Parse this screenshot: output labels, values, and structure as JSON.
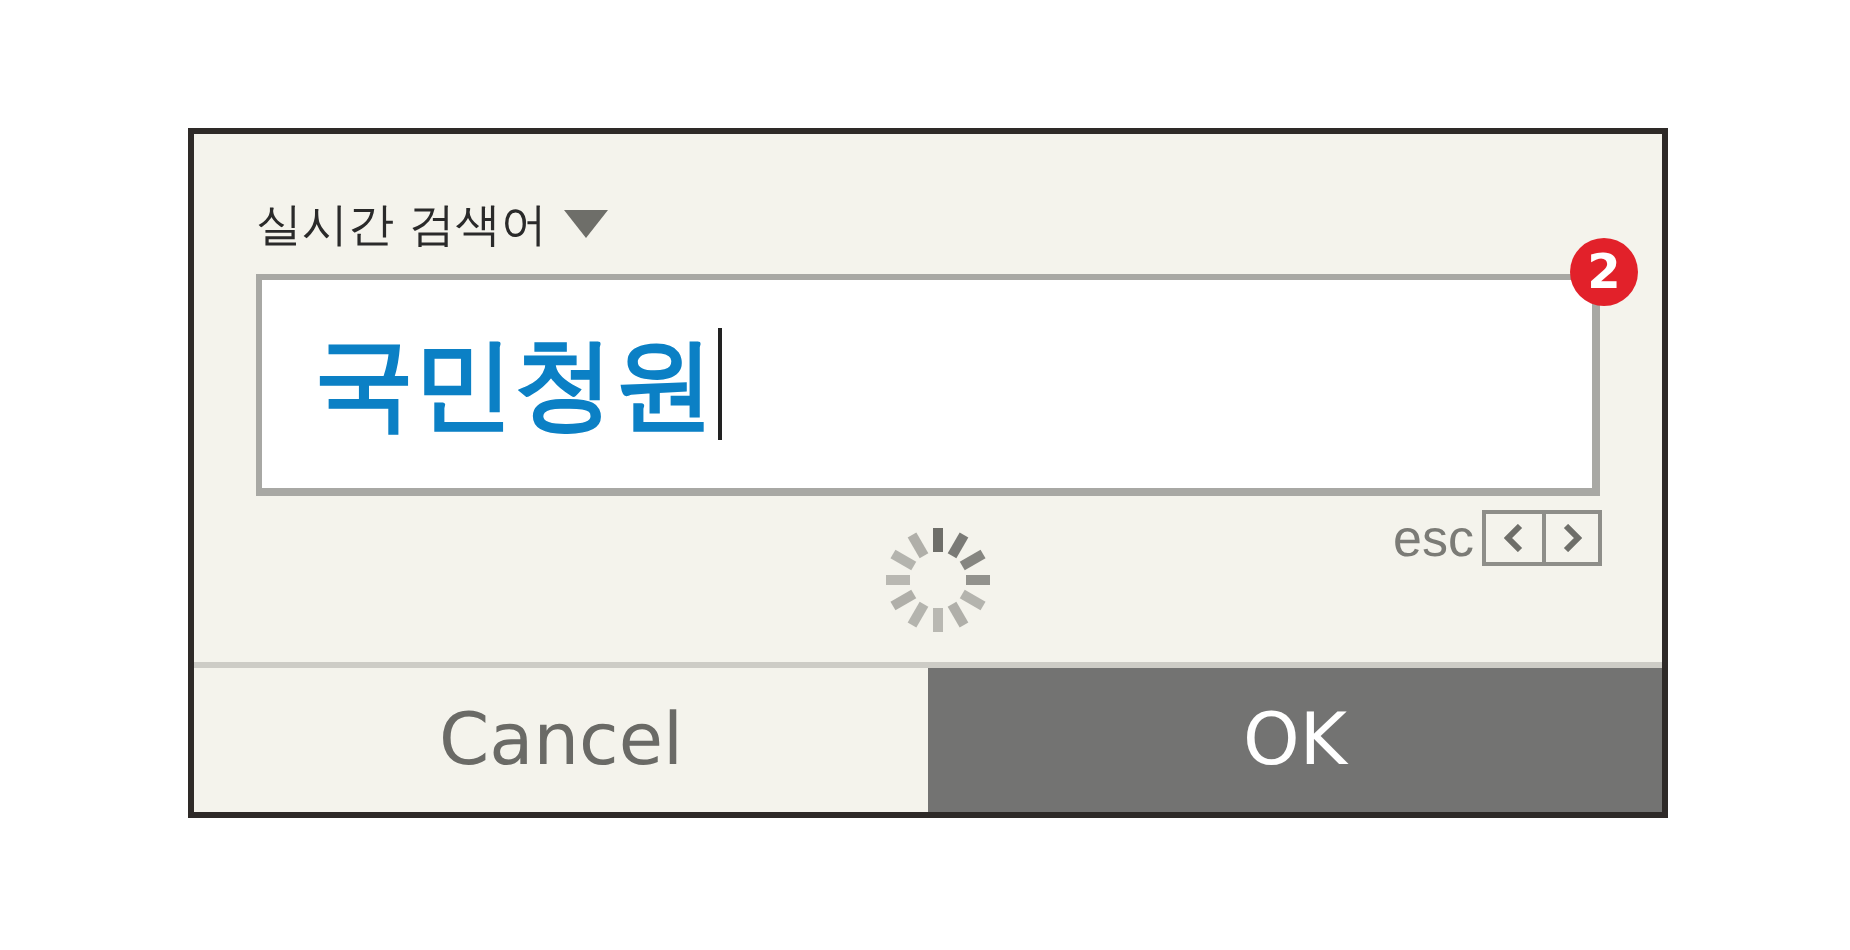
{
  "label": "실시간 검색어",
  "search": {
    "value": "국민청원",
    "badge": "2"
  },
  "hint": "esc",
  "buttons": [
    {
      "label": "Cancel",
      "selected": false
    },
    {
      "label": "OK",
      "selected": true
    }
  ]
}
